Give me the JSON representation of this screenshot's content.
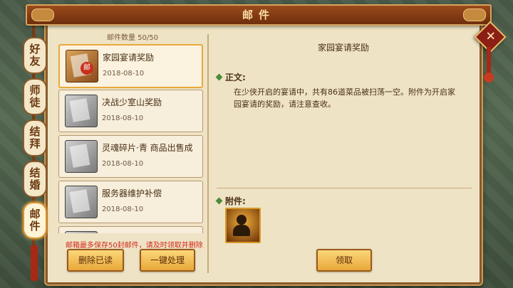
{
  "window": {
    "title": "邮件"
  },
  "close": {
    "glyph": "✕"
  },
  "sidebar": {
    "tabs": [
      {
        "label": "好友",
        "active": false
      },
      {
        "label": "师徒",
        "active": false
      },
      {
        "label": "结拜",
        "active": false
      },
      {
        "label": "结婚",
        "active": false
      },
      {
        "label": "邮件",
        "active": true
      }
    ]
  },
  "mail_list": {
    "count_label": "邮件数量 50/50",
    "items": [
      {
        "title": "家园宴请奖励",
        "date": "2018-08-10",
        "icon": "gold-mail-icon",
        "selected": true
      },
      {
        "title": "决战少室山奖励",
        "date": "2018-08-10",
        "icon": "gray-mail-icon",
        "selected": false
      },
      {
        "title": "灵魂碎片·青 商品出售成",
        "date": "2018-08-10",
        "icon": "gray-mail-icon",
        "selected": false
      },
      {
        "title": "服务器维护补偿",
        "date": "2018-08-10",
        "icon": "gray-mail-icon",
        "selected": false
      },
      {
        "title": "",
        "date": "",
        "icon": "gray-mail-icon",
        "selected": false
      }
    ],
    "warning": "邮箱最多保存50封邮件，请及时领取并删除",
    "delete_read_label": "删除已读",
    "one_click_label": "一键处理"
  },
  "detail": {
    "title": "家园宴请奖励",
    "body_label": "正文:",
    "body": "在少侠开启的宴请中，共有86道菜品被扫荡一空。附件为开启家园宴请的奖励，请注意查收。",
    "attachment_label": "附件:",
    "claim_label": "领取"
  }
}
